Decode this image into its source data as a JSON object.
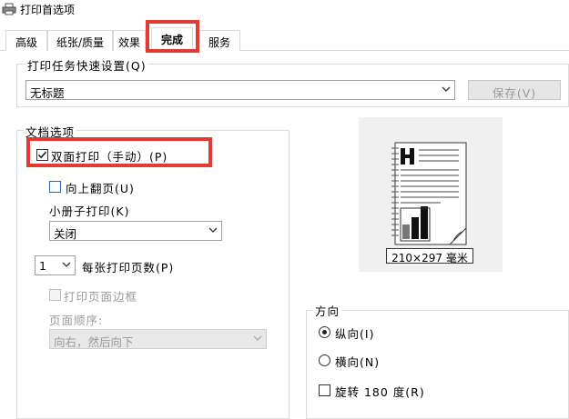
{
  "window": {
    "title": "打印首选项"
  },
  "tabs": [
    {
      "label": "高级"
    },
    {
      "label": "纸张/质量"
    },
    {
      "label": "效果"
    },
    {
      "label": "完成"
    },
    {
      "label": "服务"
    }
  ],
  "quick_set": {
    "label": "打印任务快速设置(Q)",
    "value": "无标题",
    "save_label": "保存(V)"
  },
  "document_options": {
    "label": "文档选项",
    "duplex_label": "双面打印（手动）(P)",
    "duplex_checked": true,
    "flip_up_label": "向上翻页(U)",
    "booklet_label": "小册子打印(K)",
    "booklet_value": "关闭",
    "pages_per_sheet_value": "1",
    "pages_per_sheet_label": "每张打印页数(P)",
    "print_borders_label": "打印页面边框",
    "page_order_label": "页面顺序:",
    "page_order_value": "向右，然后向下"
  },
  "preview": {
    "size_label": "210×297 毫米"
  },
  "orientation": {
    "label": "方向",
    "portrait_label": "纵向(I)",
    "landscape_label": "横向(N)",
    "rotate_label": "旋转 180 度(R)",
    "selected": "portrait"
  },
  "colors": {
    "highlight_red": "#e53935",
    "checkbox_blue": "#1e66c8"
  }
}
